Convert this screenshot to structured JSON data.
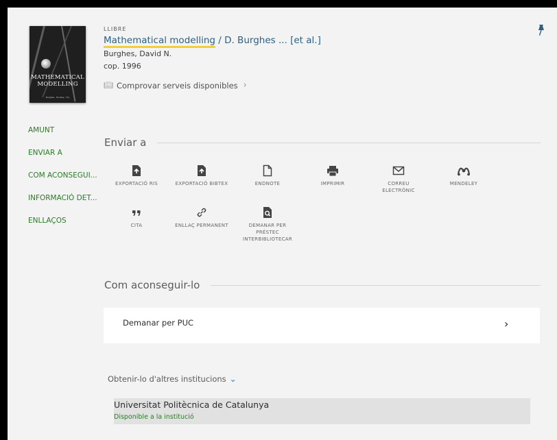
{
  "record": {
    "type_label": "LLIBRE",
    "title": "Mathematical modelling",
    "title_suffix": " / D. Burghes ... [et al.]",
    "author": "Burghes, David N.",
    "date": "cop. 1996",
    "check_services": "Comprovar serveis disponibles",
    "cover": {
      "title_line1": "MATHEMATICAL",
      "title_line2": "MODELLING"
    }
  },
  "nav": {
    "items": [
      {
        "label": "AMUNT"
      },
      {
        "label": "ENVIAR A"
      },
      {
        "label": "COM ACONSEGUI..."
      },
      {
        "label": "INFORMACIÓ DET..."
      },
      {
        "label": "ENLLAÇOS"
      }
    ]
  },
  "send_to": {
    "heading": "Enviar a",
    "actions": [
      {
        "label": "EXPORTACIÓ RIS",
        "icon": "export-file-icon"
      },
      {
        "label": "EXPORTACIÓ BIBTEX",
        "icon": "export-file-icon"
      },
      {
        "label": "ENDNOTE",
        "icon": "file-icon"
      },
      {
        "label": "IMPRIMIR",
        "icon": "print-icon"
      },
      {
        "label": "CORREU ELECTRÒNIC",
        "icon": "mail-icon"
      },
      {
        "label": "MENDELEY",
        "icon": "mendeley-icon"
      },
      {
        "label": "CITA",
        "icon": "quote-icon"
      },
      {
        "label": "ENLLAÇ PERMANENT",
        "icon": "link-icon"
      },
      {
        "label": "DEMANAR PER PRÉSTEC INTERBIBLIOTECAR",
        "icon": "search-file-icon"
      }
    ]
  },
  "get_it": {
    "heading": "Com aconseguir-lo",
    "request_label": "Demanar per PUC",
    "other_institutions": "Obtenir-lo d'altres institucions",
    "institution": {
      "name": "Universitat Politècnica de Catalunya",
      "availability": "Disponible a la institució"
    }
  },
  "colors": {
    "link": "#2e5f7f",
    "nav": "#2b7a26",
    "available": "#2b7a26",
    "highlight": "#f1cf3a",
    "background": "#f3f3f3"
  }
}
